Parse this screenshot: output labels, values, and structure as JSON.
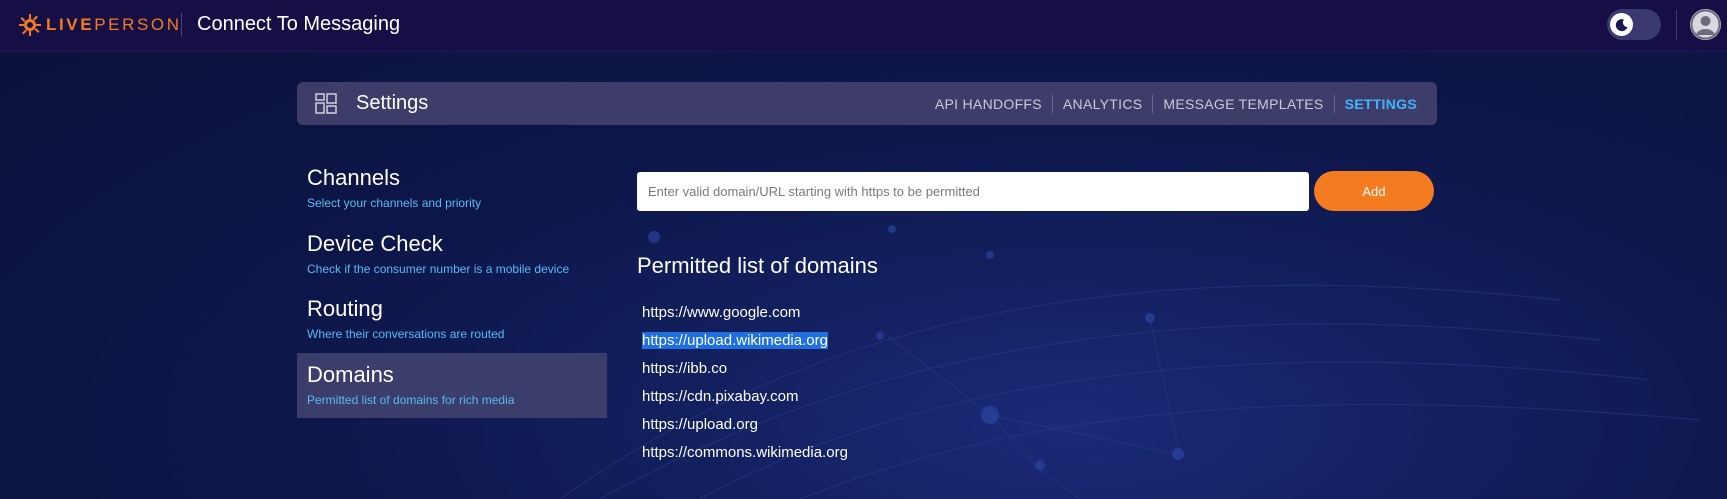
{
  "header": {
    "logo_text_bold": "LIVE",
    "logo_text_light": "PERSON",
    "app_title": "Connect To Messaging",
    "theme_toggle_icon": "moon-icon",
    "avatar_icon": "user-icon"
  },
  "settings_bar": {
    "title": "Settings",
    "icon": "dashboard-grid-icon",
    "nav": [
      {
        "label": "API HANDOFFS"
      },
      {
        "label": "ANALYTICS"
      },
      {
        "label": "MESSAGE TEMPLATES"
      },
      {
        "label": "SETTINGS",
        "active": true
      }
    ]
  },
  "side_menu": {
    "items": [
      {
        "title": "Channels",
        "subtitle": "Select your channels and priority"
      },
      {
        "title": "Device Check",
        "subtitle": "Check if the consumer number is a mobile device"
      },
      {
        "title": "Routing",
        "subtitle": "Where their conversations are routed"
      },
      {
        "title": "Domains",
        "subtitle": "Permitted list of domains for rich media",
        "active": true
      }
    ]
  },
  "domains": {
    "input_placeholder": "Enter valid domain/URL starting with https to be permitted",
    "input_value": "",
    "add_label": "Add",
    "list_title": "Permitted list of domains",
    "list": [
      "https://www.google.com",
      "https://upload.wikimedia.org",
      "https://ibb.co",
      "https://cdn.pixabay.com",
      "https://upload.org",
      "https://commons.wikimedia.org"
    ],
    "selected_index": 1
  },
  "colors": {
    "accent_orange": "#f47b20",
    "link_blue": "#58baf5",
    "nav_active": "#3fb4ff",
    "topbar": "#150f45"
  }
}
